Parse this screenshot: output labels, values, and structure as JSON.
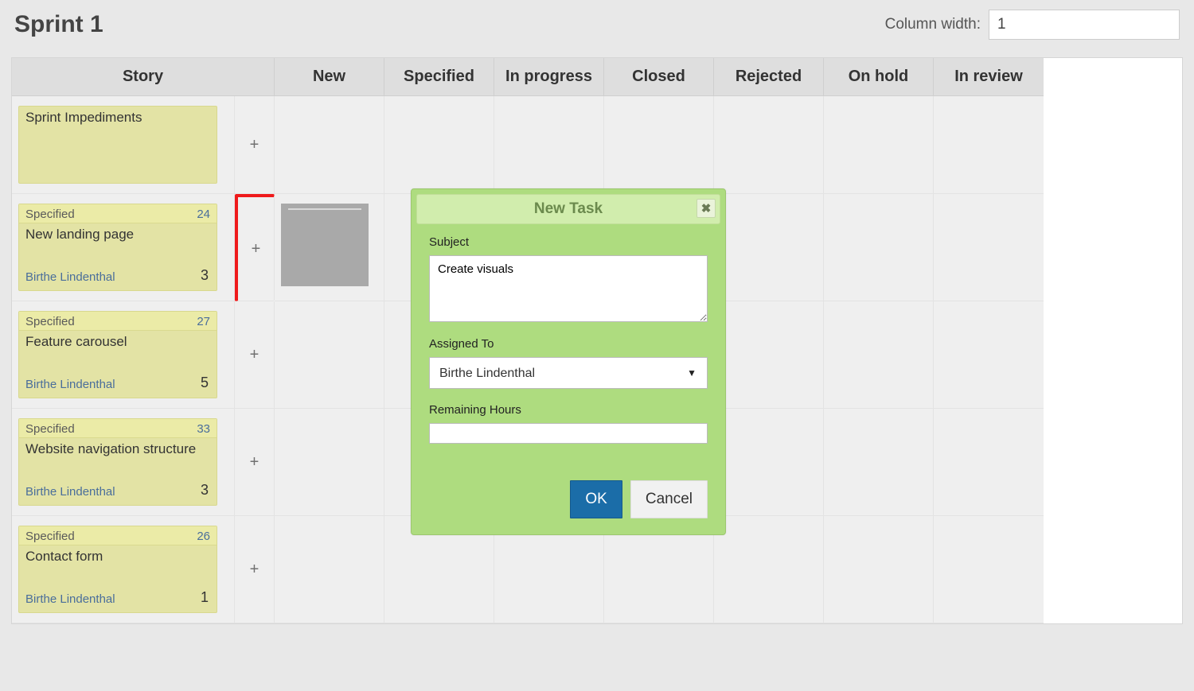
{
  "header": {
    "title": "Sprint 1",
    "column_width_label": "Column width:",
    "column_width_value": "1"
  },
  "columns": [
    "Story",
    "New",
    "Specified",
    "In progress",
    "Closed",
    "Rejected",
    "On hold",
    "In review"
  ],
  "stories": [
    {
      "status": "",
      "id": "",
      "title": "Sprint Impediments",
      "assignee": "",
      "points": "",
      "show_meta": false,
      "show_status": false,
      "highlight_plus": false,
      "has_new_task": false
    },
    {
      "status": "Specified",
      "id": "24",
      "title": "New landing page",
      "assignee": "Birthe Lindenthal",
      "points": "3",
      "show_meta": true,
      "show_status": true,
      "highlight_plus": true,
      "has_new_task": true
    },
    {
      "status": "Specified",
      "id": "27",
      "title": "Feature carousel",
      "assignee": "Birthe Lindenthal",
      "points": "5",
      "show_meta": true,
      "show_status": true,
      "highlight_plus": false,
      "has_new_task": false
    },
    {
      "status": "Specified",
      "id": "33",
      "title": "Website navigation structure",
      "assignee": "Birthe Lindenthal",
      "points": "3",
      "show_meta": true,
      "show_status": true,
      "highlight_plus": false,
      "has_new_task": false
    },
    {
      "status": "Specified",
      "id": "26",
      "title": "Contact form",
      "assignee": "Birthe Lindenthal",
      "points": "1",
      "show_meta": true,
      "show_status": true,
      "highlight_plus": false,
      "has_new_task": false
    }
  ],
  "icons": {
    "plus": "+",
    "close": "✖",
    "caret": "▼"
  },
  "dialog": {
    "title": "New Task",
    "subject_label": "Subject",
    "subject_value": "Create visuals",
    "assigned_label": "Assigned To",
    "assigned_value": "Birthe Lindenthal",
    "hours_label": "Remaining Hours",
    "hours_value": "",
    "ok": "OK",
    "cancel": "Cancel"
  }
}
